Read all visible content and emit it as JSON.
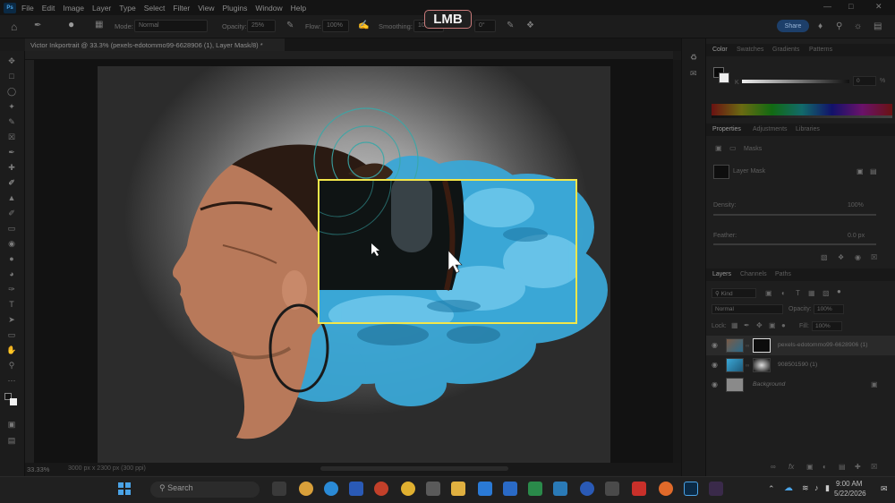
{
  "menubar": {
    "app_logo": "Ps",
    "items": [
      "File",
      "Edit",
      "Image",
      "Layer",
      "Type",
      "Select",
      "Filter",
      "View",
      "Plugins",
      "Window",
      "Help"
    ]
  },
  "options_bar": {
    "mode_label": "Mode:",
    "mode_value": "Normal",
    "opacity_label": "Opacity:",
    "opacity_value": "25%",
    "flow_label": "Flow:",
    "flow_value": "100%",
    "smoothing_label": "Smoothing:",
    "smoothing_value": "10%",
    "angle_value": "0°",
    "share_label": "Share"
  },
  "overlay": {
    "mouse_button": "LMB"
  },
  "document": {
    "tab_title": "Victor Inkportrait @ 33.3% (pexels-edotommo99-6628906 (1), Layer Mask/8) *",
    "zoom": "33.33%",
    "doc_info": "3000 px x 2300 px (300 ppi)"
  },
  "color_panel": {
    "tabs": [
      "Color",
      "Swatches",
      "Gradients",
      "Patterns"
    ],
    "slider_label": "K",
    "slider_value": "0",
    "percent": "%"
  },
  "properties_panel": {
    "tabs": [
      "Properties",
      "Adjustments",
      "Libraries"
    ],
    "masks_label": "Masks",
    "layer_mask_label": "Layer Mask",
    "density_label": "Density:",
    "density_value": "100%",
    "feather_label": "Feather:",
    "feather_value": "0.0 px"
  },
  "layers_panel": {
    "tabs": [
      "Layers",
      "Channels",
      "Paths"
    ],
    "kind_label": "Kind",
    "blend_mode": "Normal",
    "opacity_label": "Opacity:",
    "opacity_value": "100%",
    "lock_label": "Lock:",
    "fill_label": "Fill:",
    "fill_value": "100%",
    "layers": [
      {
        "name": "pexels-edotommo99-6628906 (1)",
        "selected": true
      },
      {
        "name": "908501590 (1)",
        "selected": false
      },
      {
        "name": "Background",
        "selected": false
      }
    ]
  },
  "taskbar": {
    "search_label": "Search",
    "time": "9:00 AM",
    "date": "5/22/2026"
  },
  "colors": {
    "selection_outline": "#f3e64a",
    "smoke_blue": "#3aa7d6",
    "share_button": "#1d3f6a",
    "lmb_border": "#c97a7a"
  }
}
